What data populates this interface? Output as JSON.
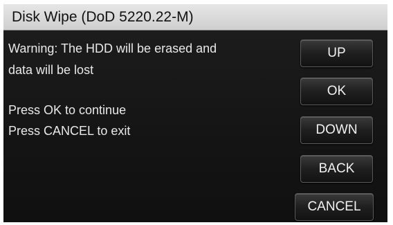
{
  "window": {
    "title": "Disk Wipe (DoD 5220.22-M)"
  },
  "message": {
    "warning_line1": "Warning: The HDD will be erased and",
    "warning_line2": "data will be lost",
    "instruction_ok": "Press OK to continue",
    "instruction_cancel": "Press CANCEL to exit"
  },
  "buttons": {
    "up": "UP",
    "ok": "OK",
    "down": "DOWN",
    "back": "BACK",
    "cancel": "CANCEL"
  },
  "colors": {
    "title_bar": "#dcdcdc",
    "screen_background": "#141414",
    "text": "#e9e9e9"
  }
}
